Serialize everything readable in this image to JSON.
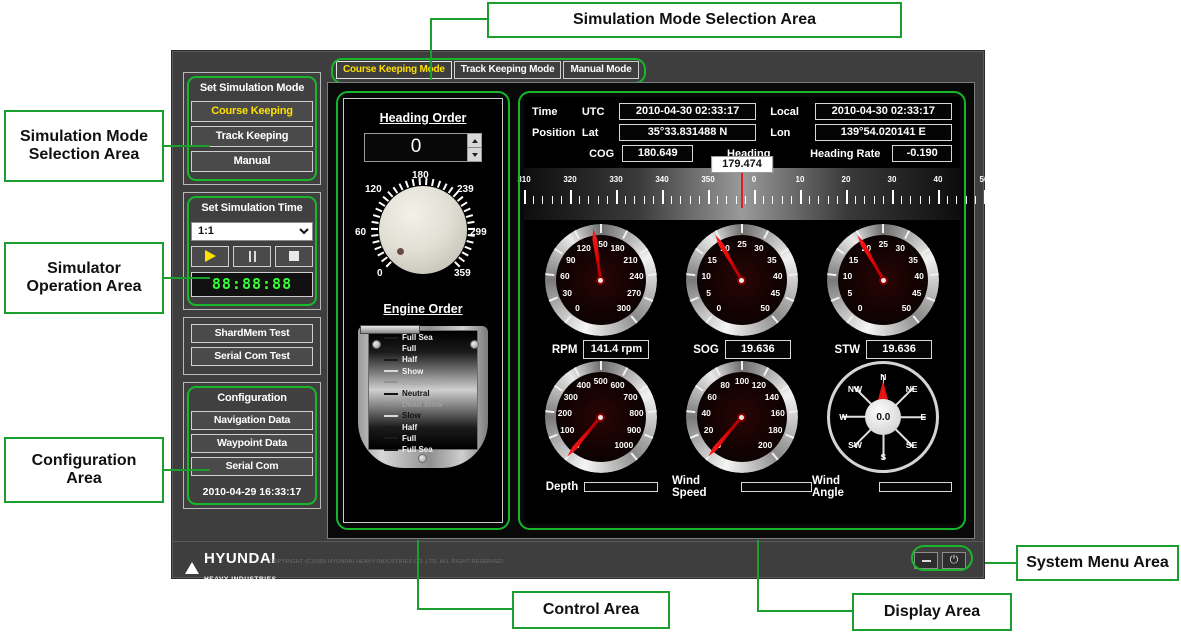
{
  "annotations": [
    {
      "id": "a-mode-top",
      "text": "Simulation Mode Selection Area"
    },
    {
      "id": "a-mode-left",
      "text": "Simulation Mode\nSelection Area"
    },
    {
      "id": "a-sim-op",
      "text": "Simulator\nOperation Area"
    },
    {
      "id": "a-config",
      "text": "Configuration\nArea"
    },
    {
      "id": "a-control",
      "text": "Control Area"
    },
    {
      "id": "a-display",
      "text": "Display Area"
    },
    {
      "id": "a-system",
      "text": "System Menu Area"
    }
  ],
  "accent_green": "#17b62b",
  "accent_yellow": "#ffe000",
  "sidebar": {
    "mode_group": {
      "title": "Set Simulation Mode",
      "buttons": [
        {
          "label": "Course Keeping",
          "active": true
        },
        {
          "label": "Track Keeping",
          "active": false
        },
        {
          "label": "Manual",
          "active": false
        }
      ]
    },
    "time_group": {
      "title": "Set Simulation Time",
      "rate_selected": "1:1",
      "rate_options": [
        "1:1"
      ],
      "play_label": "play",
      "pause_label": "pause",
      "stop_label": "stop",
      "clock": "88:88:88"
    },
    "test_group": {
      "buttons": [
        {
          "label": "ShardMem Test"
        },
        {
          "label": "Serial Com Test"
        }
      ]
    },
    "config_group": {
      "title": "Configuration",
      "buttons": [
        {
          "label": "Navigation Data"
        },
        {
          "label": "Waypoint Data"
        },
        {
          "label": "Serial Com"
        }
      ],
      "datetime": "2010-04-29 16:33:17"
    }
  },
  "tabs": [
    {
      "label": "Course Keeping Mode",
      "active": true
    },
    {
      "label": "Track Keeping Mode",
      "active": false
    },
    {
      "label": "Manual Mode",
      "active": false
    }
  ],
  "control_area": {
    "heading_order": {
      "title": "Heading Order",
      "value": "0",
      "knob_labels": [
        "0",
        "60",
        "120",
        "180",
        "239",
        "299",
        "359"
      ]
    },
    "engine_order": {
      "title": "Engine Order",
      "steps": [
        {
          "label": "Full Sea",
          "dim": false
        },
        {
          "label": "Full",
          "dim": false
        },
        {
          "label": "Half",
          "dim": false
        },
        {
          "label": "Show",
          "dim": false
        },
        {
          "label": "Dead Slow",
          "dim": true
        },
        {
          "label": "Neutral",
          "dim": false
        },
        {
          "label": "Dead Slow",
          "dim": true
        },
        {
          "label": "Slow",
          "dim": false
        },
        {
          "label": "Half",
          "dim": false
        },
        {
          "label": "Full",
          "dim": false
        },
        {
          "label": "Full Sea",
          "dim": false
        }
      ]
    }
  },
  "display_area": {
    "time_label": "Time",
    "utc_label": "UTC",
    "utc_value": "2010-04-30  02:33:17",
    "local_label": "Local",
    "local_value": "2010-04-30  02:33:17",
    "position_label": "Position",
    "lat_label": "Lat",
    "lat_value": "35°33.831488 N",
    "lon_label": "Lon",
    "lon_value": "139°54.020141 E",
    "cog_label": "COG",
    "cog_value": "180.649",
    "heading_label": "Heading",
    "heading_value": "179.474",
    "heading_rate_label": "Heading Rate",
    "heading_rate_value": "-0.190",
    "heading_scale_ticks": [
      "310",
      "320",
      "330",
      "340",
      "350",
      "0",
      "10",
      "20",
      "30",
      "40",
      "50"
    ]
  },
  "chart_data": [
    {
      "type": "gauge",
      "name": "RPM",
      "value": 141.4,
      "display_value": "141.4 rpm",
      "min": 0,
      "max": 300,
      "ticks": [
        "0",
        "30",
        "60",
        "90",
        "120",
        "150",
        "180",
        "210",
        "240",
        "270",
        "300"
      ]
    },
    {
      "type": "gauge",
      "name": "SOG",
      "value": 19.636,
      "display_value": "19.636",
      "min": 0,
      "max": 50,
      "ticks": [
        "0",
        "5",
        "10",
        "15",
        "20",
        "25",
        "30",
        "35",
        "40",
        "45",
        "50"
      ]
    },
    {
      "type": "gauge",
      "name": "STW",
      "value": 19.636,
      "display_value": "19.636",
      "min": 0,
      "max": 50,
      "ticks": [
        "0",
        "5",
        "10",
        "15",
        "20",
        "25",
        "30",
        "35",
        "40",
        "45",
        "50"
      ]
    },
    {
      "type": "gauge",
      "name": "Depth",
      "value": 0,
      "display_value": "",
      "min": 0,
      "max": 1000,
      "ticks": [
        "0",
        "100",
        "200",
        "300",
        "400",
        "500",
        "600",
        "700",
        "800",
        "900",
        "1000"
      ]
    },
    {
      "type": "gauge",
      "name": "Wind Speed",
      "value": 0,
      "display_value": "",
      "min": 0,
      "max": 200,
      "ticks": [
        "0",
        "20",
        "40",
        "60",
        "80",
        "100",
        "120",
        "140",
        "160",
        "180",
        "200"
      ]
    },
    {
      "type": "compass",
      "name": "Wind Angle",
      "value": 0.0,
      "center_value": "0.0",
      "display_value": "",
      "ticks": [
        "N",
        "NE",
        "E",
        "SE",
        "S",
        "SW",
        "W",
        "NW"
      ]
    }
  ],
  "footer": {
    "logo_line1": "HYUNDAI",
    "logo_line2": "HEAVY INDUSTRIES",
    "copyright": "COPYRIGHT (C)2009 HYUNDAI HEAVY INDUSTRIES CO.,LTD. ALL RIGHT RESERVED.",
    "minimize_label": "minimize",
    "power_label": "power"
  }
}
